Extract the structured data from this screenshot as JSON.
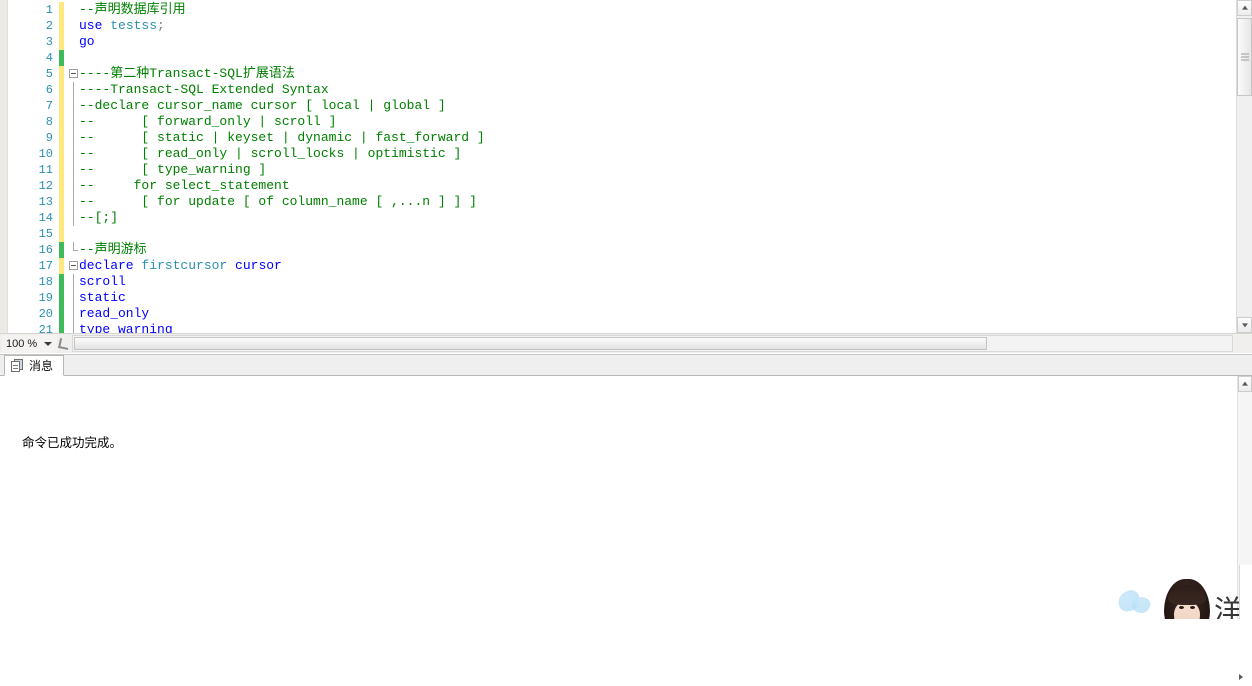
{
  "editor": {
    "name": "sql-query-editor",
    "lines": [
      {
        "num": "1",
        "bar": "yellow",
        "outline": "none",
        "tokens": [
          {
            "t": "--声明数据库引用",
            "c": "comment"
          }
        ]
      },
      {
        "num": "2",
        "bar": "yellow",
        "outline": "none",
        "tokens": [
          {
            "t": "use ",
            "c": "kw"
          },
          {
            "t": "testss",
            "c": "id"
          },
          {
            "t": ";",
            "c": "punc"
          }
        ]
      },
      {
        "num": "3",
        "bar": "yellow",
        "outline": "none",
        "tokens": [
          {
            "t": "go",
            "c": "kw"
          }
        ]
      },
      {
        "num": "4",
        "bar": "green",
        "outline": "none",
        "tokens": [
          {
            "t": "",
            "c": "plain"
          }
        ]
      },
      {
        "num": "5",
        "bar": "yellow",
        "outline": "box",
        "tokens": [
          {
            "t": "----第二种Transact-SQL扩展语法",
            "c": "comment"
          }
        ]
      },
      {
        "num": "6",
        "bar": "yellow",
        "outline": "line",
        "tokens": [
          {
            "t": "----Transact-SQL Extended Syntax",
            "c": "comment"
          }
        ]
      },
      {
        "num": "7",
        "bar": "yellow",
        "outline": "line",
        "tokens": [
          {
            "t": "--declare cursor_name cursor [ local | global ]",
            "c": "comment"
          }
        ]
      },
      {
        "num": "8",
        "bar": "yellow",
        "outline": "line",
        "tokens": [
          {
            "t": "--      [ forward_only | scroll ]",
            "c": "comment"
          }
        ]
      },
      {
        "num": "9",
        "bar": "yellow",
        "outline": "line",
        "tokens": [
          {
            "t": "--      [ static | keyset | dynamic | fast_forward ]",
            "c": "comment"
          }
        ]
      },
      {
        "num": "10",
        "bar": "yellow",
        "outline": "line",
        "tokens": [
          {
            "t": "--      [ read_only | scroll_locks | optimistic ]",
            "c": "comment"
          }
        ]
      },
      {
        "num": "11",
        "bar": "yellow",
        "outline": "line",
        "tokens": [
          {
            "t": "--      [ type_warning ]",
            "c": "comment"
          }
        ]
      },
      {
        "num": "12",
        "bar": "yellow",
        "outline": "line",
        "tokens": [
          {
            "t": "--     for select_statement",
            "c": "comment"
          }
        ]
      },
      {
        "num": "13",
        "bar": "yellow",
        "outline": "line",
        "tokens": [
          {
            "t": "--      [ for update [ of column_name [ ,...n ] ] ]",
            "c": "comment"
          }
        ]
      },
      {
        "num": "14",
        "bar": "yellow",
        "outline": "line",
        "tokens": [
          {
            "t": "--[;]",
            "c": "comment"
          }
        ]
      },
      {
        "num": "15",
        "bar": "yellow",
        "outline": "none",
        "tokens": [
          {
            "t": "",
            "c": "plain"
          }
        ]
      },
      {
        "num": "16",
        "bar": "green",
        "outline": "end",
        "tokens": [
          {
            "t": "--声明游标",
            "c": "comment"
          }
        ]
      },
      {
        "num": "17",
        "bar": "yellow",
        "outline": "box",
        "tokens": [
          {
            "t": "declare ",
            "c": "kw"
          },
          {
            "t": "firstcursor ",
            "c": "id"
          },
          {
            "t": "cursor",
            "c": "kw"
          }
        ]
      },
      {
        "num": "18",
        "bar": "green",
        "outline": "line",
        "tokens": [
          {
            "t": "scroll",
            "c": "kw"
          }
        ]
      },
      {
        "num": "19",
        "bar": "green",
        "outline": "line",
        "tokens": [
          {
            "t": "static",
            "c": "kw"
          }
        ]
      },
      {
        "num": "20",
        "bar": "green",
        "outline": "line",
        "tokens": [
          {
            "t": "read_only",
            "c": "kw"
          }
        ]
      },
      {
        "num": "21",
        "bar": "green",
        "outline": "line",
        "tokens": [
          {
            "t": "type_warning",
            "c": "kw"
          }
        ]
      }
    ]
  },
  "bottombar": {
    "zoom_value": "100 %",
    "zoom_caret_icon": "chevron-down-icon",
    "splitter_icon": "split-handle-icon",
    "hscroll_right_arrow_icon": "arrow-right-icon"
  },
  "results": {
    "tabs": [
      {
        "label": "消息",
        "icon": "messages-icon",
        "selected": true
      }
    ],
    "message_text": "命令已成功完成。"
  },
  "scrollbars": {
    "editor_vertical_up_icon": "arrow-up-icon",
    "editor_vertical_down_icon": "arrow-down-icon",
    "results_vertical_up_icon": "arrow-up-icon"
  },
  "wallpaper": {
    "glyph": "洋"
  },
  "colors": {
    "comment": "#008000",
    "keyword": "#0000ff",
    "identifier": "#2b91af",
    "line_number": "#2b91af",
    "changed_unsaved": "#ffe97f",
    "changed_saved": "#3fba5a",
    "editor_background": "#ffffff"
  }
}
